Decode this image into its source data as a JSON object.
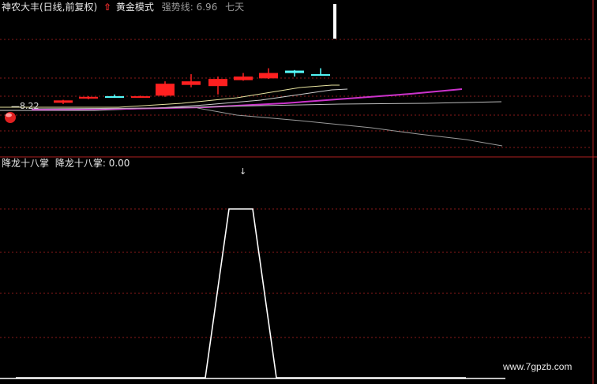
{
  "top_panel": {
    "title": "神农大丰(日线,前复权)",
    "arrow": "up-arrow-icon",
    "formula": "黄金模式",
    "indicator_label": "强势线: 6.96",
    "extra": "七天",
    "price_tag": "8.22",
    "colors": {
      "up": "#ff2020",
      "down": "#55ffff",
      "magenta": "#cc33cc",
      "white": "#ffffff",
      "grid": "#8a1a1a"
    },
    "candles": [
      {
        "open": 8.3,
        "close": 8.26,
        "high": 8.31,
        "low": 8.24,
        "dir": "up"
      },
      {
        "open": 8.36,
        "close": 8.33,
        "high": 8.37,
        "low": 8.32,
        "dir": "up"
      },
      {
        "open": 8.36,
        "close": 8.37,
        "high": 8.4,
        "low": 8.35,
        "dir": "down"
      },
      {
        "open": 8.37,
        "close": 8.36,
        "high": 8.38,
        "low": 8.35,
        "dir": "up"
      },
      {
        "open": 8.58,
        "close": 8.38,
        "high": 8.62,
        "low": 8.36,
        "dir": "up"
      },
      {
        "open": 8.62,
        "close": 8.56,
        "high": 8.74,
        "low": 8.52,
        "dir": "up"
      },
      {
        "open": 8.66,
        "close": 8.54,
        "high": 8.7,
        "low": 8.4,
        "dir": "up"
      },
      {
        "open": 8.7,
        "close": 8.64,
        "high": 8.76,
        "low": 8.63,
        "dir": "up"
      },
      {
        "open": 8.76,
        "close": 8.67,
        "high": 8.84,
        "low": 8.66,
        "dir": "up"
      },
      {
        "open": 8.8,
        "close": 8.76,
        "high": 8.81,
        "low": 8.7,
        "dir": "down"
      },
      {
        "open": 8.74,
        "close": 8.73,
        "high": 8.84,
        "low": 8.73,
        "dir": "down"
      }
    ]
  },
  "bottom_panel": {
    "title": "降龙十八掌",
    "value_label": "降龙十八掌: 0.00",
    "top_marker": "↓",
    "signal": [
      0,
      0,
      0,
      0,
      0,
      0,
      0,
      0,
      0,
      1,
      1,
      0,
      0,
      0,
      0,
      0,
      0,
      0,
      0,
      0
    ]
  },
  "watermark": "www.7gpzb.com"
}
